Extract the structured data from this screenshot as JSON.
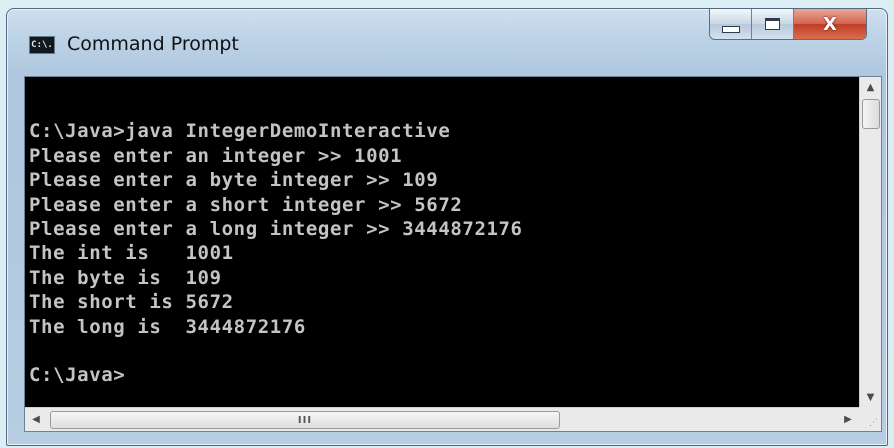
{
  "window": {
    "title": "Command Prompt",
    "icon_label": "C:\\.",
    "controls": {
      "minimize": "minimize",
      "maximize": "maximize",
      "close": "X"
    }
  },
  "console": {
    "lines": [
      "",
      "C:\\Java>java IntegerDemoInteractive",
      "Please enter an integer >> 1001",
      "Please enter a byte integer >> 109",
      "Please enter a short integer >> 5672",
      "Please enter a long integer >> 3444872176",
      "The int is   1001",
      "The byte is  109",
      "The short is 5672",
      "The long is  3444872176",
      "",
      "C:\\Java>"
    ],
    "text_color": "#c4c4c4",
    "background": "#000000"
  },
  "scrollbars": {
    "up_arrow": "▲",
    "down_arrow": "▼",
    "left_arrow": "◀",
    "right_arrow": "▶",
    "grip": "III",
    "resize_grip": "⋰"
  }
}
